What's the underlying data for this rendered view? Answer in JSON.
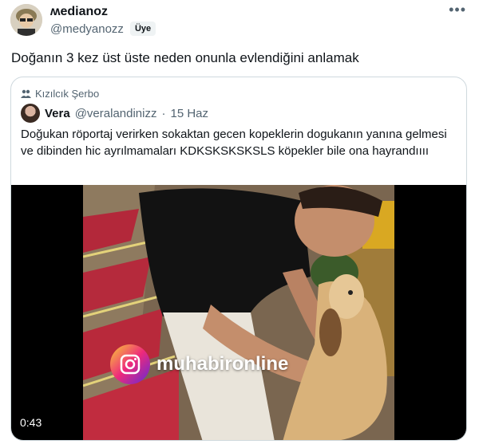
{
  "tweet": {
    "display_name": "ʍedianoz",
    "handle": "@medyanozz",
    "badge": "Üye",
    "more_icon": "more-icon",
    "text": "Doğanın 3 kez üst üste neden onunla evlendiğini anlamak"
  },
  "quote": {
    "social_context": "Kızılcık Şerbo",
    "author_name": "Vera",
    "author_handle": "@veralandinizz",
    "separator": "·",
    "date": "15 Haz",
    "text": "Doğukan röportaj verirken sokaktan gecen kopeklerin dogukanın yanına gelmesi ve dibinden hic ayrılmamaları KDKSKSKSKSLS köpekler bile ona hayrandıııı",
    "video": {
      "watermark": "muhabironline",
      "duration": "0:43"
    }
  },
  "colors": {
    "text": "#0f1419",
    "muted": "#536471",
    "border": "#cfd9de"
  }
}
